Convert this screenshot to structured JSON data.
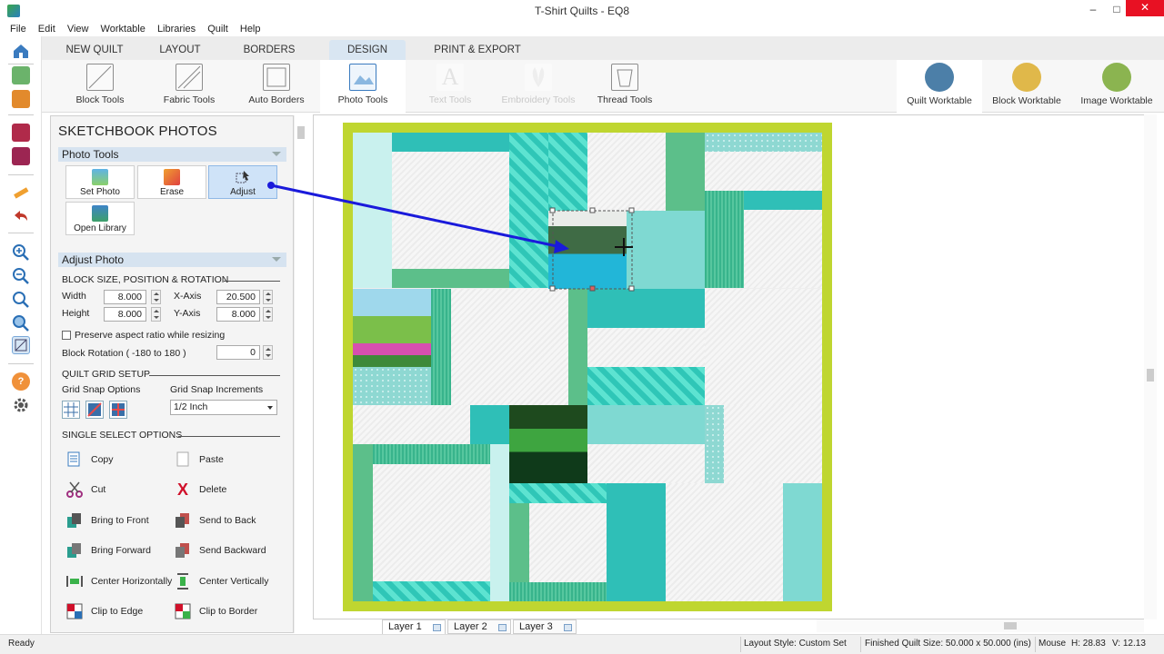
{
  "window": {
    "title": "T-Shirt Quilts - EQ8",
    "minimize": "–",
    "maximize": "□",
    "close": "✕"
  },
  "menu": [
    "File",
    "Edit",
    "View",
    "Worktable",
    "Libraries",
    "Quilt",
    "Help"
  ],
  "ribbon_tabs": [
    "NEW QUILT",
    "LAYOUT",
    "BORDERS",
    "DESIGN",
    "PRINT & EXPORT"
  ],
  "active_tab": "DESIGN",
  "tools": {
    "block": "Block Tools",
    "fabric": "Fabric Tools",
    "auto_borders": "Auto Borders",
    "photo": "Photo Tools",
    "text": "Text Tools",
    "embroidery": "Embroidery Tools",
    "thread": "Thread Tools"
  },
  "worktables": {
    "quilt": "Quilt Worktable",
    "block": "Block Worktable",
    "image": "Image Worktable"
  },
  "panel": {
    "title": "SKETCHBOOK PHOTOS",
    "photo_tools": {
      "header": "Photo Tools",
      "set_photo": "Set Photo",
      "erase": "Erase",
      "adjust": "Adjust",
      "open_library": "Open Library"
    },
    "adjust_photo": {
      "header": "Adjust Photo",
      "block_section": "BLOCK SIZE, POSITION & ROTATION",
      "width_label": "Width",
      "width_value": "8.000",
      "height_label": "Height",
      "height_value": "8.000",
      "xaxis_label": "X-Axis",
      "xaxis_value": "20.500",
      "yaxis_label": "Y-Axis",
      "yaxis_value": "8.000",
      "preserve_label": "Preserve aspect ratio while resizing",
      "rotation_label": "Block Rotation ( -180 to 180 )",
      "rotation_value": "0",
      "grid_section": "QUILT GRID SETUP",
      "snap_options_label": "Grid Snap Options",
      "snap_increments_label": "Grid Snap Increments",
      "snap_increment_value": "1/2 Inch",
      "single_select_section": "SINGLE SELECT OPTIONS",
      "options": {
        "copy": "Copy",
        "paste": "Paste",
        "cut": "Cut",
        "delete": "Delete",
        "bring_to_front": "Bring to Front",
        "send_to_back": "Send to Back",
        "bring_forward": "Bring Forward",
        "send_backward": "Send Backward",
        "center_h": "Center Horizontally",
        "center_v": "Center Vertically",
        "clip_edge": "Clip to Edge",
        "clip_border": "Clip to Border"
      }
    }
  },
  "layers": [
    "Layer 1",
    "Layer 2",
    "Layer 3"
  ],
  "status": {
    "ready": "Ready",
    "layout_style": "Layout Style: Custom Set",
    "finished_size": "Finished Quilt Size: 50.000 x 50.000 (ins)",
    "mouse": "Mouse",
    "h": "H: 28.83",
    "v": "V: 12.13"
  },
  "colors": {
    "accent": "#d9e6f2",
    "border_green": "#bfd630",
    "aqua": "#7fd9d2",
    "teal": "#2fbfb7",
    "arrow": "#1a1adb"
  }
}
